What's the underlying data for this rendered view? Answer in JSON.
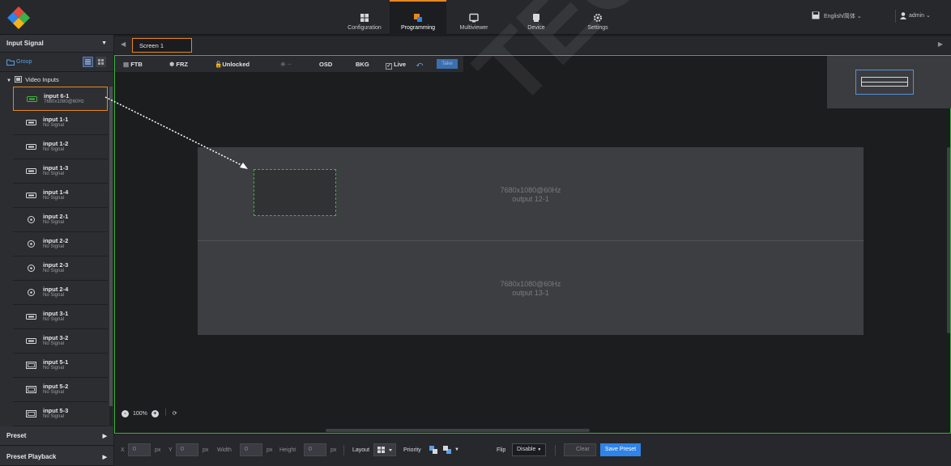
{
  "nav": {
    "tabs": [
      {
        "label": "Configuration",
        "icon": "configuration-icon"
      },
      {
        "label": "Programming",
        "icon": "programming-icon"
      },
      {
        "label": "Multiviewer",
        "icon": "multiviewer-icon"
      },
      {
        "label": "Device",
        "icon": "device-icon"
      },
      {
        "label": "Settings",
        "icon": "settings-icon"
      }
    ],
    "active": "Programming",
    "language": "English/简体",
    "user": "admin"
  },
  "left": {
    "input_signal": "Input Signal",
    "group": "Group",
    "video_inputs": "Video Inputs",
    "inputs": [
      {
        "name": "input 6-1",
        "status": "7680x1080@60Hz",
        "type": "hdmi",
        "selected": true
      },
      {
        "name": "input 1-1",
        "status": "No Signal",
        "type": "hdmi"
      },
      {
        "name": "input 1-2",
        "status": "No Signal",
        "type": "hdmi"
      },
      {
        "name": "input 1-3",
        "status": "No Signal",
        "type": "hdmi"
      },
      {
        "name": "input 1-4",
        "status": "No Signal",
        "type": "hdmi"
      },
      {
        "name": "input 2-1",
        "status": "No Signal",
        "type": "sdi"
      },
      {
        "name": "input 2-2",
        "status": "No Signal",
        "type": "sdi"
      },
      {
        "name": "input 2-3",
        "status": "No Signal",
        "type": "sdi"
      },
      {
        "name": "input 2-4",
        "status": "No Signal",
        "type": "sdi"
      },
      {
        "name": "input 3-1",
        "status": "No Signal",
        "type": "hdmi"
      },
      {
        "name": "input 3-2",
        "status": "No Signal",
        "type": "hdmi"
      },
      {
        "name": "input 5-1",
        "status": "No Signal",
        "type": "dvi"
      },
      {
        "name": "input 5-2",
        "status": "No Signal",
        "type": "dvi"
      },
      {
        "name": "input 5-3",
        "status": "No Signal",
        "type": "dvi"
      }
    ],
    "preset": "Preset",
    "preset_playback": "Preset Playback"
  },
  "screen": {
    "tab": "Screen 1",
    "toolbar": {
      "ftb": "FTB",
      "frz": "FRZ",
      "unlocked": "Unlocked",
      "osd": "OSD",
      "bkg": "BKG",
      "live": "Live",
      "take": "Take"
    },
    "outputs": [
      {
        "resolution": "7680x1080@60Hz",
        "name": "output 12-1"
      },
      {
        "resolution": "7680x1080@60Hz",
        "name": "output 13-1"
      }
    ],
    "zoom": "100%"
  },
  "bottom": {
    "x_label": "X",
    "x": "0",
    "y_label": "Y",
    "y": "0",
    "unit": "px",
    "width_label": "Width",
    "width": "0",
    "height_label": "Height",
    "height": "0",
    "layout": "Layout",
    "priority": "Priority",
    "flip": "Flip",
    "flip_value": "Disable",
    "clear": "Clear",
    "save_preset": "Save Preset"
  },
  "watermark": "TECH CO., LTD.",
  "colors": {
    "accent_orange": "#e8871e",
    "accent_green": "#3fb43f",
    "accent_blue": "#2f84e8"
  }
}
